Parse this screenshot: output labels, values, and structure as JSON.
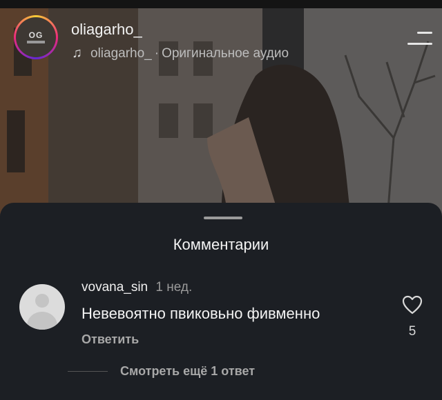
{
  "reel": {
    "author": "oliagarho_",
    "avatar_logo": "OG",
    "audio": {
      "icon": "music-note-icon",
      "artist": "oliagarho_",
      "separator": "·",
      "title": "Оригинальное аудио"
    },
    "menu_icon": "menu-icon"
  },
  "comments_sheet": {
    "title": "Комментарии",
    "comment": {
      "username": "vovana_sin",
      "time": "1 нед.",
      "text": "Невевоятно пвиковьно фивменно",
      "reply_label": "Ответить",
      "like_icon": "heart-icon",
      "like_count": "5"
    },
    "view_more_replies": "Смотреть ещё 1 ответ"
  },
  "colors": {
    "sheet_bg": "#1c1f24",
    "secondary_text": "#a8a8a8"
  }
}
